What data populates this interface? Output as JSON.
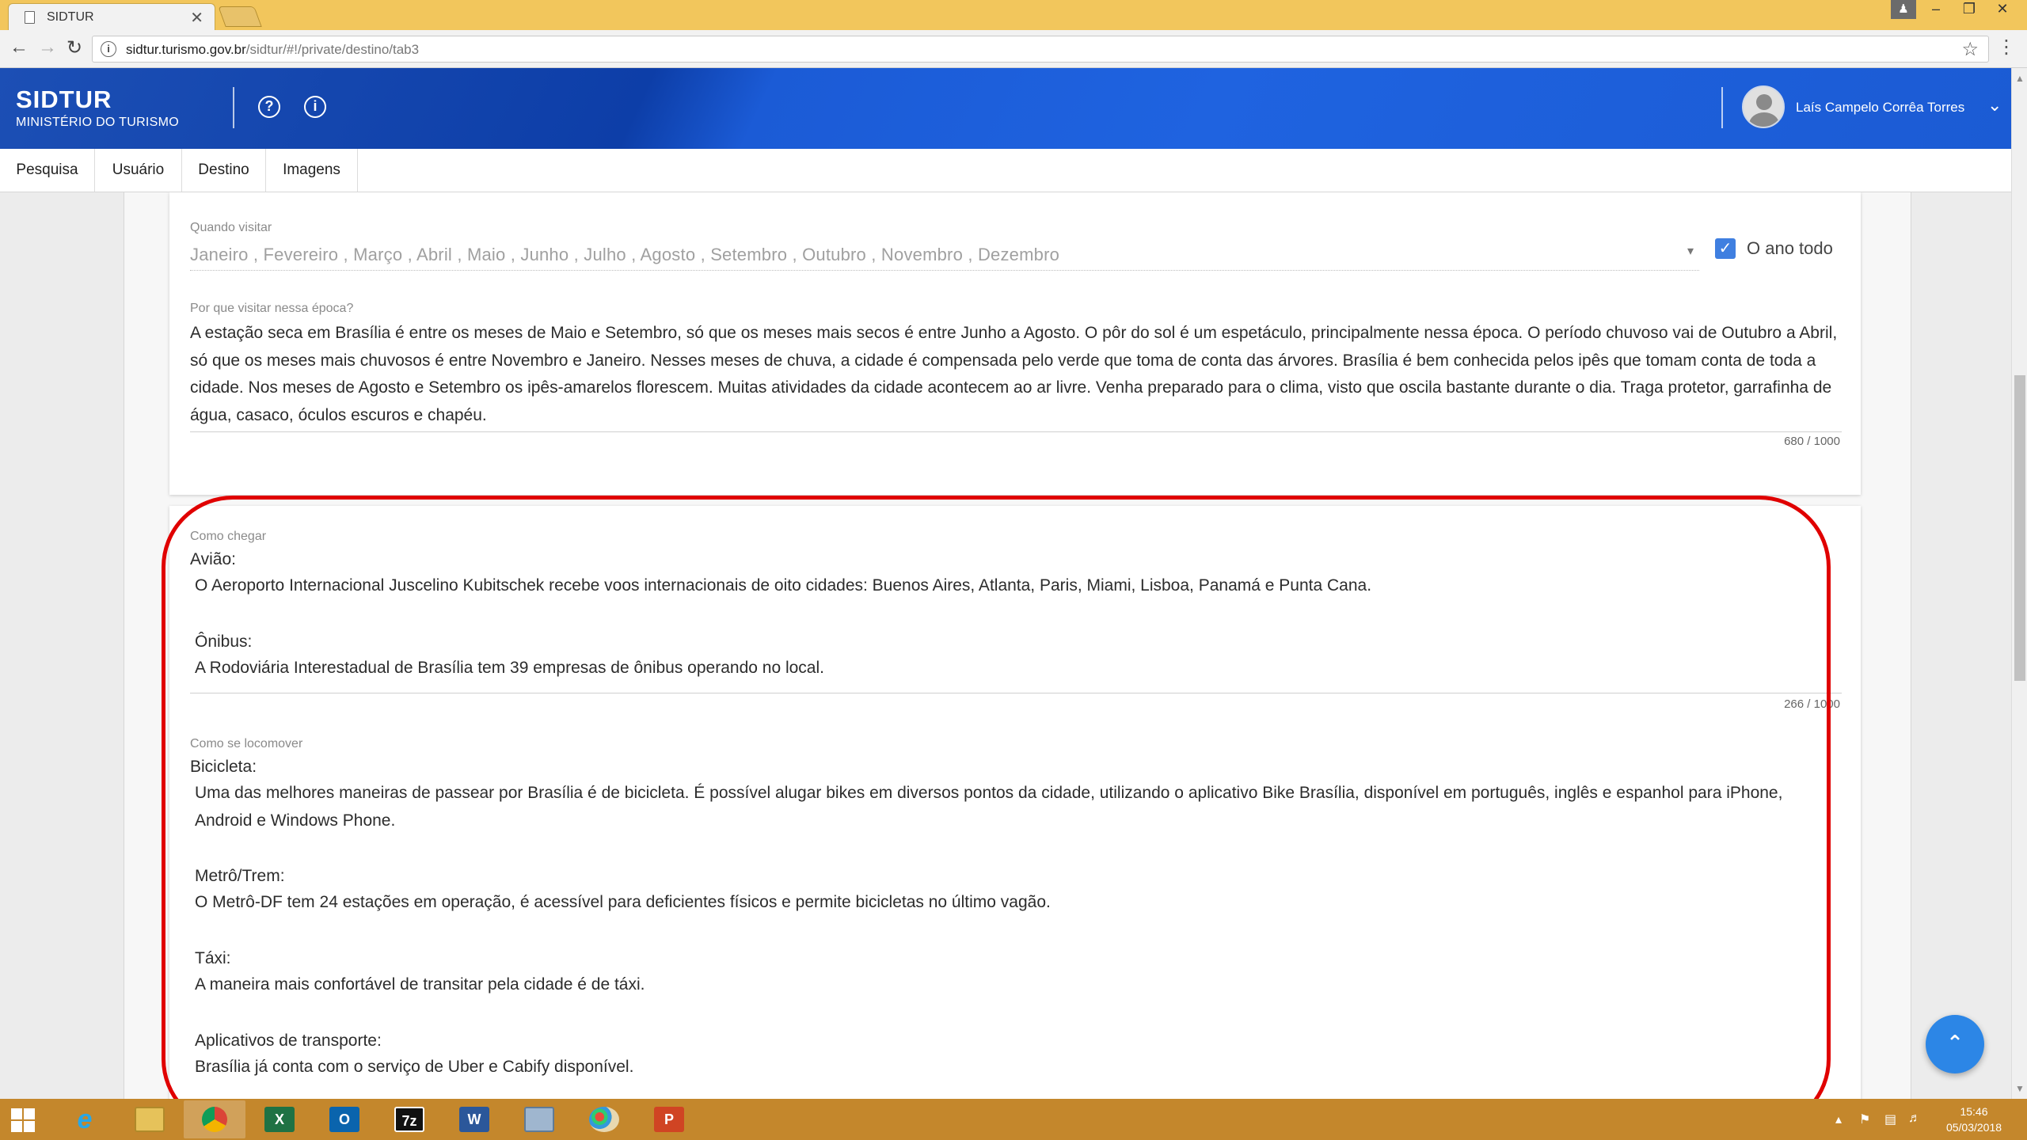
{
  "browser": {
    "tab_title": "SIDTUR",
    "tab_close": "✕",
    "url_host": "sidtur.turismo.gov.br",
    "url_path": "/sidtur/#!/private/destino/tab3"
  },
  "header": {
    "brand": "SIDTUR",
    "subtitle": "MINISTÉRIO DO TURISMO",
    "user_name": "Laís Campelo Corrêa Torres"
  },
  "nav": {
    "tabs": [
      {
        "label": "Pesquisa"
      },
      {
        "label": "Usuário"
      },
      {
        "label": "Destino"
      },
      {
        "label": "Imagens"
      }
    ]
  },
  "when_to_visit": {
    "label": "Quando visitar",
    "months": "Janeiro , Fevereiro , Março , Abril , Maio , Junho , Julho , Agosto , Setembro , Outubro , Novembro , Dezembro",
    "all_year_label": "O ano todo",
    "all_year_checked": true
  },
  "why_visit": {
    "label": "Por que visitar nessa época?",
    "text": "A estação seca em Brasília é entre os meses de Maio e Setembro, só que os meses mais secos é entre Junho a Agosto. O pôr do sol é um espetáculo, principalmente nessa época. O período chuvoso vai de Outubro a Abril, só que os meses mais chuvosos é entre Novembro e Janeiro. Nesses meses de chuva, a cidade é compensada pelo verde que toma de conta das árvores. Brasília é bem conhecida pelos ipês que tomam conta de toda a cidade. Nos meses de Agosto e Setembro os ipês-amarelos florescem. Muitas atividades da cidade acontecem ao ar livre. Venha preparado para o clima, visto que oscila bastante durante o dia. Traga protetor, garrafinha de água, casaco, óculos escuros e chapéu.",
    "counter": "680 / 1000"
  },
  "how_to_get": {
    "label": "Como chegar",
    "sections": [
      {
        "title": "Avião:",
        "text": "O Aeroporto Internacional Juscelino Kubitschek recebe voos internacionais de oito cidades: Buenos Aires, Atlanta, Paris, Miami, Lisboa, Panamá e Punta Cana."
      },
      {
        "title": "Ônibus:",
        "text": "A Rodoviária Interestadual de Brasília tem 39 empresas de ônibus operando no local."
      }
    ],
    "counter": "266 / 1000"
  },
  "getting_around": {
    "label": "Como se locomover",
    "sections": [
      {
        "title": "Bicicleta:",
        "text": "Uma das melhores maneiras de passear por Brasília é de bicicleta. É possível alugar bikes em diversos pontos da cidade, utilizando o aplicativo Bike Brasília, disponível em português, inglês e espanhol para iPhone, Android e Windows Phone."
      },
      {
        "title": "Metrô/Trem:",
        "text": "O Metrô-DF tem 24 estações em operação, é acessível para deficientes físicos e permite bicicletas no último vagão."
      },
      {
        "title": "Táxi:",
        "text": "A maneira mais confortável de transitar pela cidade é de táxi."
      },
      {
        "title": "Aplicativos de transporte:",
        "text": "Brasília já conta com o serviço de Uber e Cabify disponível."
      }
    ]
  },
  "taskbar": {
    "time": "15:46",
    "date": "05/03/2018",
    "apps": [
      "internet-explorer",
      "file-explorer",
      "chrome",
      "excel",
      "outlook",
      "7zip",
      "word",
      "control-panel",
      "paint",
      "powerpoint"
    ]
  },
  "colors": {
    "header_blue": "#1b5bd6",
    "highlight_red": "#e00000",
    "checkbox_blue": "#3f7fe0",
    "fab_blue": "#2c86e6",
    "taskbar": "#c4872c"
  }
}
